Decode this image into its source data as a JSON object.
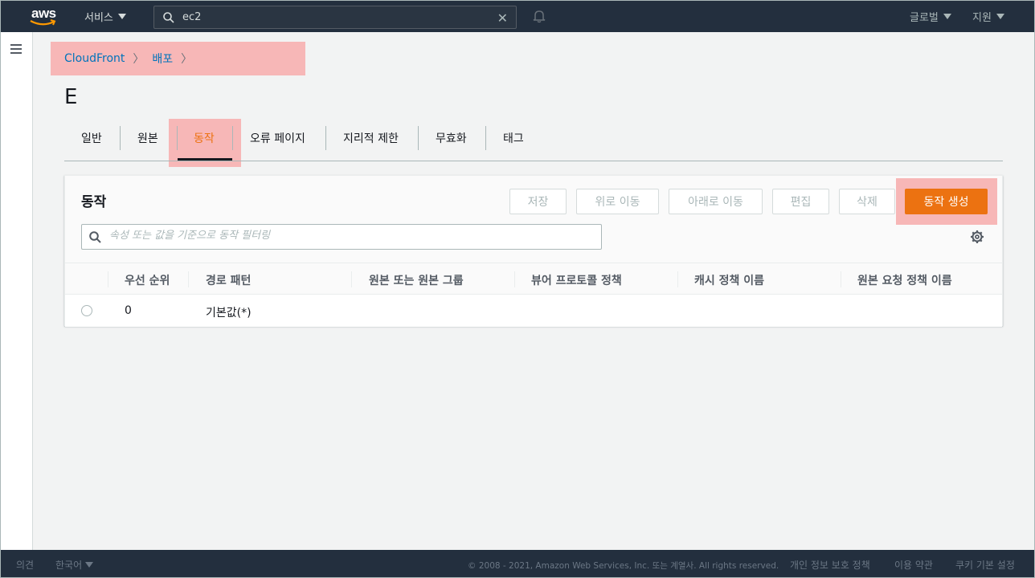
{
  "topnav": {
    "logo": "aws",
    "services_label": "서비스",
    "search_value": "ec2",
    "region_label": "글로벌",
    "support_label": "지원"
  },
  "breadcrumb": {
    "items": [
      "CloudFront",
      "배포"
    ]
  },
  "page_title": "E",
  "tabs": [
    {
      "label": "일반"
    },
    {
      "label": "원본"
    },
    {
      "label": "동작",
      "active": true
    },
    {
      "label": "오류 페이지"
    },
    {
      "label": "지리적 제한"
    },
    {
      "label": "무효화"
    },
    {
      "label": "태그"
    }
  ],
  "panel": {
    "title": "동작",
    "buttons": {
      "save": "저장",
      "move_up": "위로 이동",
      "move_down": "아래로 이동",
      "edit": "편집",
      "delete": "삭제",
      "create": "동작 생성"
    },
    "filter_placeholder": "속성 또는 값을 기준으로 동작 필터링"
  },
  "table": {
    "columns": [
      "우선 순위",
      "경로 패턴",
      "원본 또는 원본 그룹",
      "뷰어 프로토콜 정책",
      "캐시 정책 이름",
      "원본 요청 정책 이름"
    ],
    "rows": [
      {
        "priority": "0",
        "path": "기본값(*)"
      }
    ]
  },
  "footer": {
    "feedback": "의견",
    "language": "한국어",
    "copyright": "© 2008 - 2021, Amazon Web Services, Inc. 또는 계열사. All rights reserved.",
    "privacy": "개인 정보 보호 정책",
    "terms": "이용 약관",
    "cookies": "쿠키 기본 설정"
  },
  "colors": {
    "nav_bg": "#232f3e",
    "accent": "#ec7211",
    "link": "#0073bb",
    "highlight": "#f7b7b7"
  }
}
